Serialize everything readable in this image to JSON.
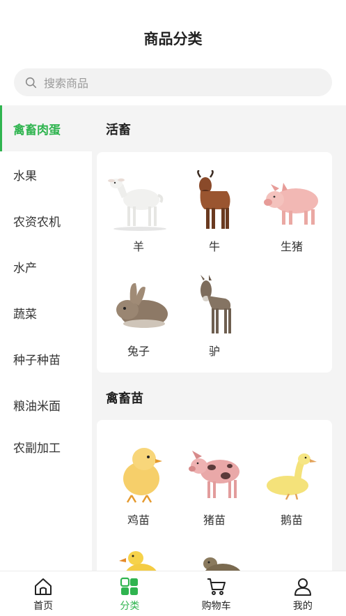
{
  "header": {
    "title": "商品分类"
  },
  "search": {
    "placeholder": "搜索商品"
  },
  "sidebar": {
    "items": [
      {
        "label": "禽畜肉蛋",
        "active": true
      },
      {
        "label": "水果"
      },
      {
        "label": "农资农机"
      },
      {
        "label": "水产"
      },
      {
        "label": "蔬菜"
      },
      {
        "label": "种子种苗"
      },
      {
        "label": "粮油米面"
      },
      {
        "label": "农副加工"
      }
    ]
  },
  "sections": [
    {
      "title": "活畜",
      "items": [
        {
          "label": "羊",
          "icon": "sheep"
        },
        {
          "label": "牛",
          "icon": "cow"
        },
        {
          "label": "生猪",
          "icon": "pig"
        },
        {
          "label": "兔子",
          "icon": "rabbit"
        },
        {
          "label": "驴",
          "icon": "donkey"
        }
      ]
    },
    {
      "title": "禽畜苗",
      "items": [
        {
          "label": "鸡苗",
          "icon": "chick"
        },
        {
          "label": "猪苗",
          "icon": "piglet"
        },
        {
          "label": "鹅苗",
          "icon": "gosling"
        },
        {
          "icon": "duckling"
        },
        {
          "icon": "quail"
        }
      ]
    }
  ],
  "tabbar": {
    "items": [
      {
        "label": "首页",
        "icon": "home-icon"
      },
      {
        "label": "分类",
        "icon": "category-icon",
        "active": true
      },
      {
        "label": "购物车",
        "icon": "cart-icon"
      },
      {
        "label": "我的",
        "icon": "user-icon"
      }
    ]
  },
  "colors": {
    "accent": "#2fb44f",
    "background": "#f4f4f4"
  }
}
